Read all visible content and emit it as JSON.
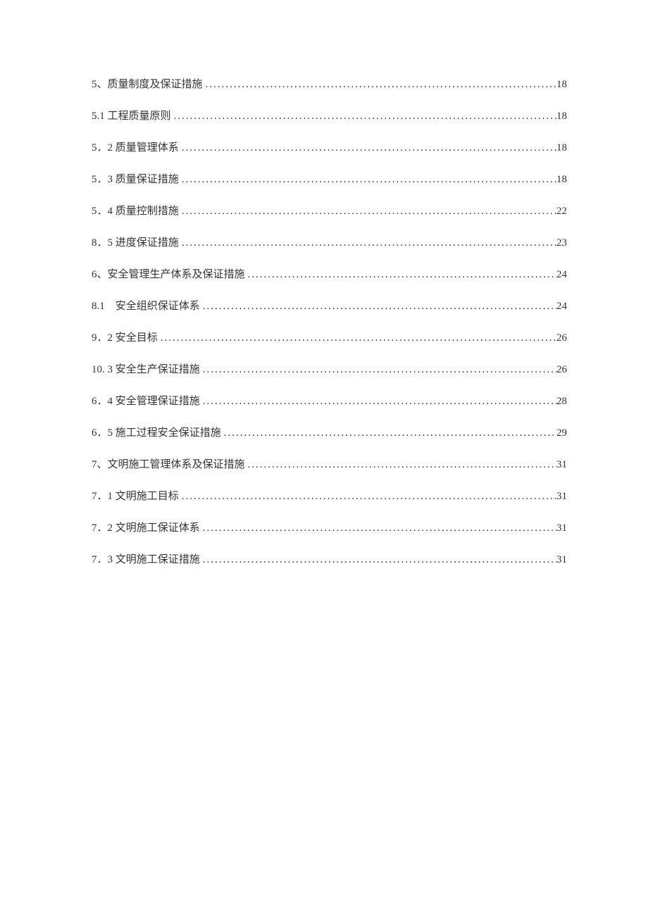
{
  "toc": {
    "entries": [
      {
        "label": "5、质量制度及保证措施",
        "page": "18"
      },
      {
        "label": "5.1 工程质量原则",
        "page": "18"
      },
      {
        "label": "5．2 质量管理体系",
        "page": "18"
      },
      {
        "label": "5．3 质量保证措施",
        "page": "18"
      },
      {
        "label": "5．4 质量控制措施",
        "page": "22"
      },
      {
        "label": "8．5 进度保证措施",
        "page": "23"
      },
      {
        "label": "6、安全管理生产体系及保证措施",
        "page": "24"
      },
      {
        "label": "8.1　安全组织保证体系",
        "page": "24"
      },
      {
        "label": "9．2 安全目标",
        "page": "26"
      },
      {
        "label": "10. 3 安全生产保证措施",
        "page": "26"
      },
      {
        "label": "6．4 安全管理保证措施",
        "page": "28"
      },
      {
        "label": "6．5 施工过程安全保证措施",
        "page": "29"
      },
      {
        "label": "7、文明施工管理体系及保证措施",
        "page": "31"
      },
      {
        "label": "7．1 文明施工目标",
        "page": "31"
      },
      {
        "label": "7．2 文明施工保证体系",
        "page": "31"
      },
      {
        "label": "7．3 文明施工保证措施",
        "page": "31"
      }
    ]
  }
}
